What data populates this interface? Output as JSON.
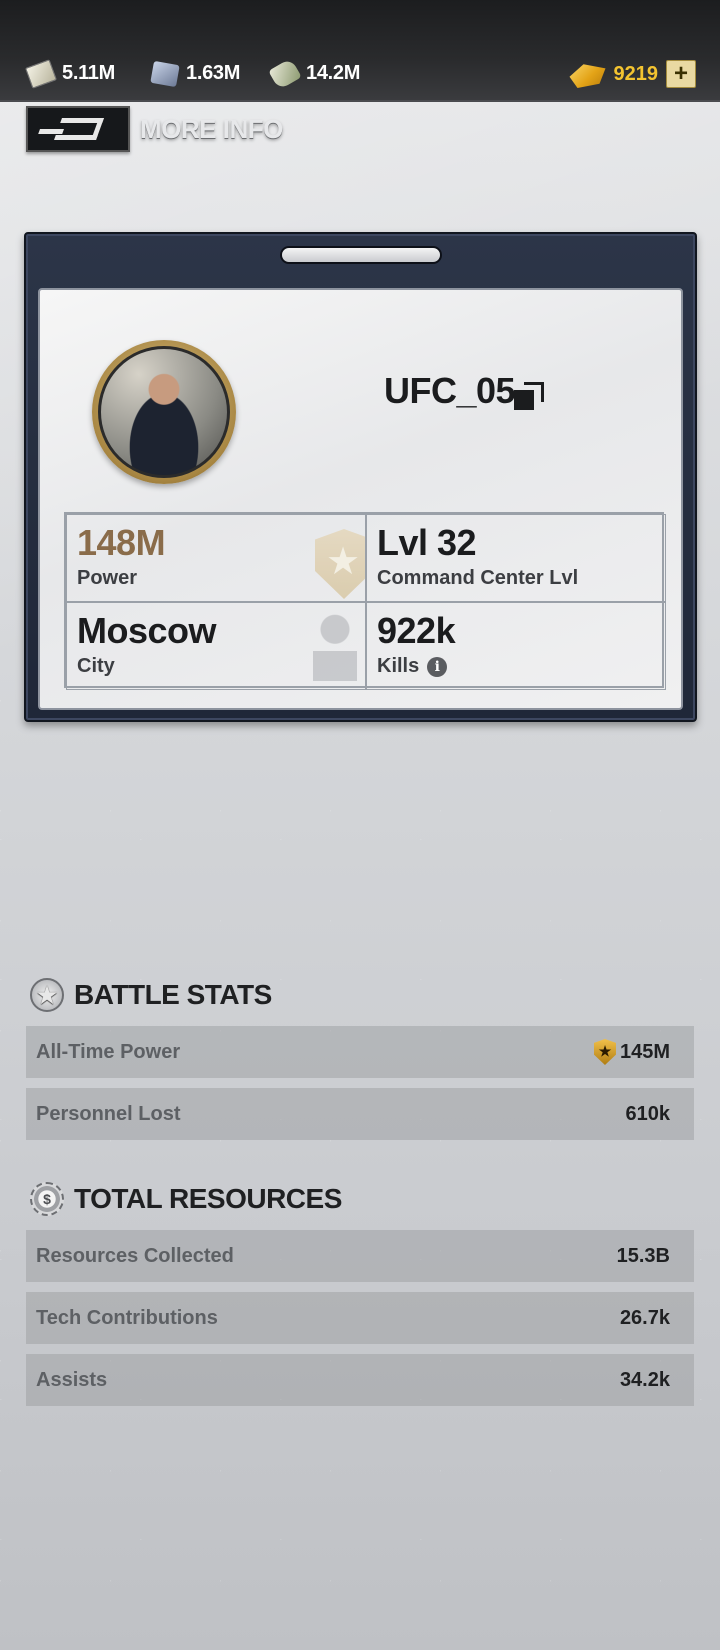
{
  "topbar": {
    "resources": [
      {
        "icon": "cash-icon",
        "value": "5.11M"
      },
      {
        "icon": "supply-cube-icon",
        "value": "1.63M"
      },
      {
        "icon": "fuel-icon",
        "value": "14.2M"
      }
    ],
    "gold": {
      "icon": "gold-bars-icon",
      "value": "9219",
      "plus_label": "+"
    }
  },
  "header": {
    "more_info_label": "MORE INFO"
  },
  "profile": {
    "username": "UFC_05",
    "stats": {
      "power_value": "148M",
      "power_label": "Power",
      "cc_value": "Lvl 32",
      "cc_label": "Command Center Lvl",
      "city_value": "Moscow",
      "city_label": "City",
      "kills_value": "922k",
      "kills_label": "Kills",
      "info_glyph": "i"
    }
  },
  "battle_stats": {
    "title": "BATTLE STATS",
    "rows": [
      {
        "label": "All-Time Power",
        "value": "145M"
      },
      {
        "label": "Personnel Lost",
        "value": "610k"
      }
    ]
  },
  "total_resources": {
    "title": "TOTAL RESOURCES",
    "badge_glyph": "$",
    "rows": [
      {
        "label": "Resources Collected",
        "value": "15.3B"
      },
      {
        "label": "Tech Contributions",
        "value": "26.7k"
      },
      {
        "label": "Assists",
        "value": "34.2k"
      }
    ]
  },
  "colors": {
    "power_accent": "#8a6c4a",
    "gold_text": "#f4c430",
    "card_frame": "#1f2738"
  }
}
